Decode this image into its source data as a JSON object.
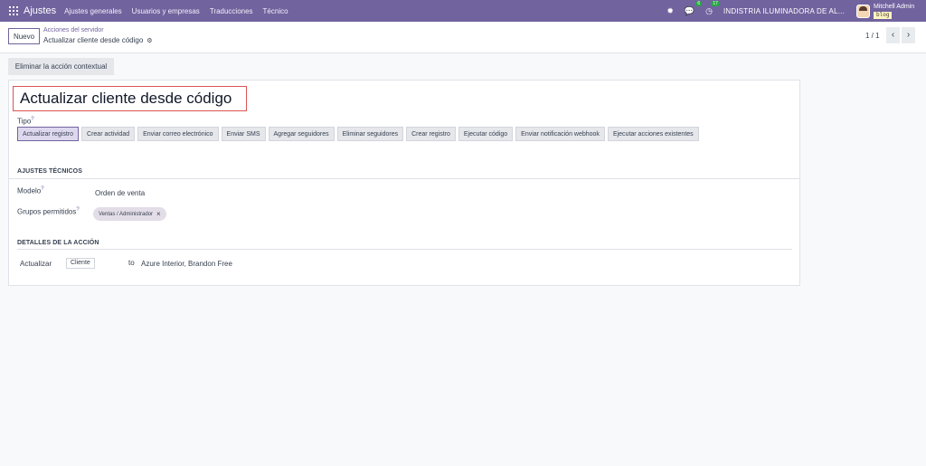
{
  "topbar": {
    "brand": "Ajustes",
    "menus": [
      "Ajustes generales",
      "Usuarios y empresas",
      "Traducciones",
      "Técnico"
    ],
    "chat_badge": "6",
    "activity_badge": "17",
    "company": "INDISTRIA ILUMINADORA DE AL...",
    "user_name": "Mitchell Admin",
    "database": "blog"
  },
  "control": {
    "new_label": "Nuevo",
    "breadcrumb_parent": "Acciones del servidor",
    "breadcrumb_current": "Actualizar cliente desde código",
    "pager": "1 / 1"
  },
  "actions": {
    "remove_contextual": "Eliminar la acción contextual"
  },
  "form": {
    "name": "Actualizar cliente desde código",
    "tipo_label": "Tipo",
    "types": [
      "Actualizar registro",
      "Crear actividad",
      "Enviar correo electrónico",
      "Enviar SMS",
      "Agregar seguidores",
      "Eliminar seguidores",
      "Crear registro",
      "Ejecutar código",
      "Enviar notificación webhook",
      "Ejecutar acciones existentes"
    ],
    "active_type": "Actualizar registro",
    "section_technical": "AJUSTES TÉCNICOS",
    "model_label": "Modelo",
    "model_value": "Orden de venta",
    "groups_label": "Grupos permitidos",
    "group_tag": "Ventas / Administrador",
    "section_action": "DETALLES DE LA ACCIÓN",
    "action_update_label": "Actualizar",
    "action_field": "Cliente",
    "action_to": "to",
    "action_value": "Azure Interior, Brandon Free"
  },
  "icons": {
    "apps": "apps-grid-icon",
    "bug": "bug-icon",
    "chat": "chat-icon",
    "activity": "clock-icon",
    "cog": "gear-icon",
    "prev": "chevron-left-icon",
    "next": "chevron-right-icon",
    "remove": "close-icon"
  },
  "colors": {
    "topbar": "#71639e",
    "accent": "#71639e",
    "title_border": "#dc5454",
    "badge": "#28a745"
  }
}
